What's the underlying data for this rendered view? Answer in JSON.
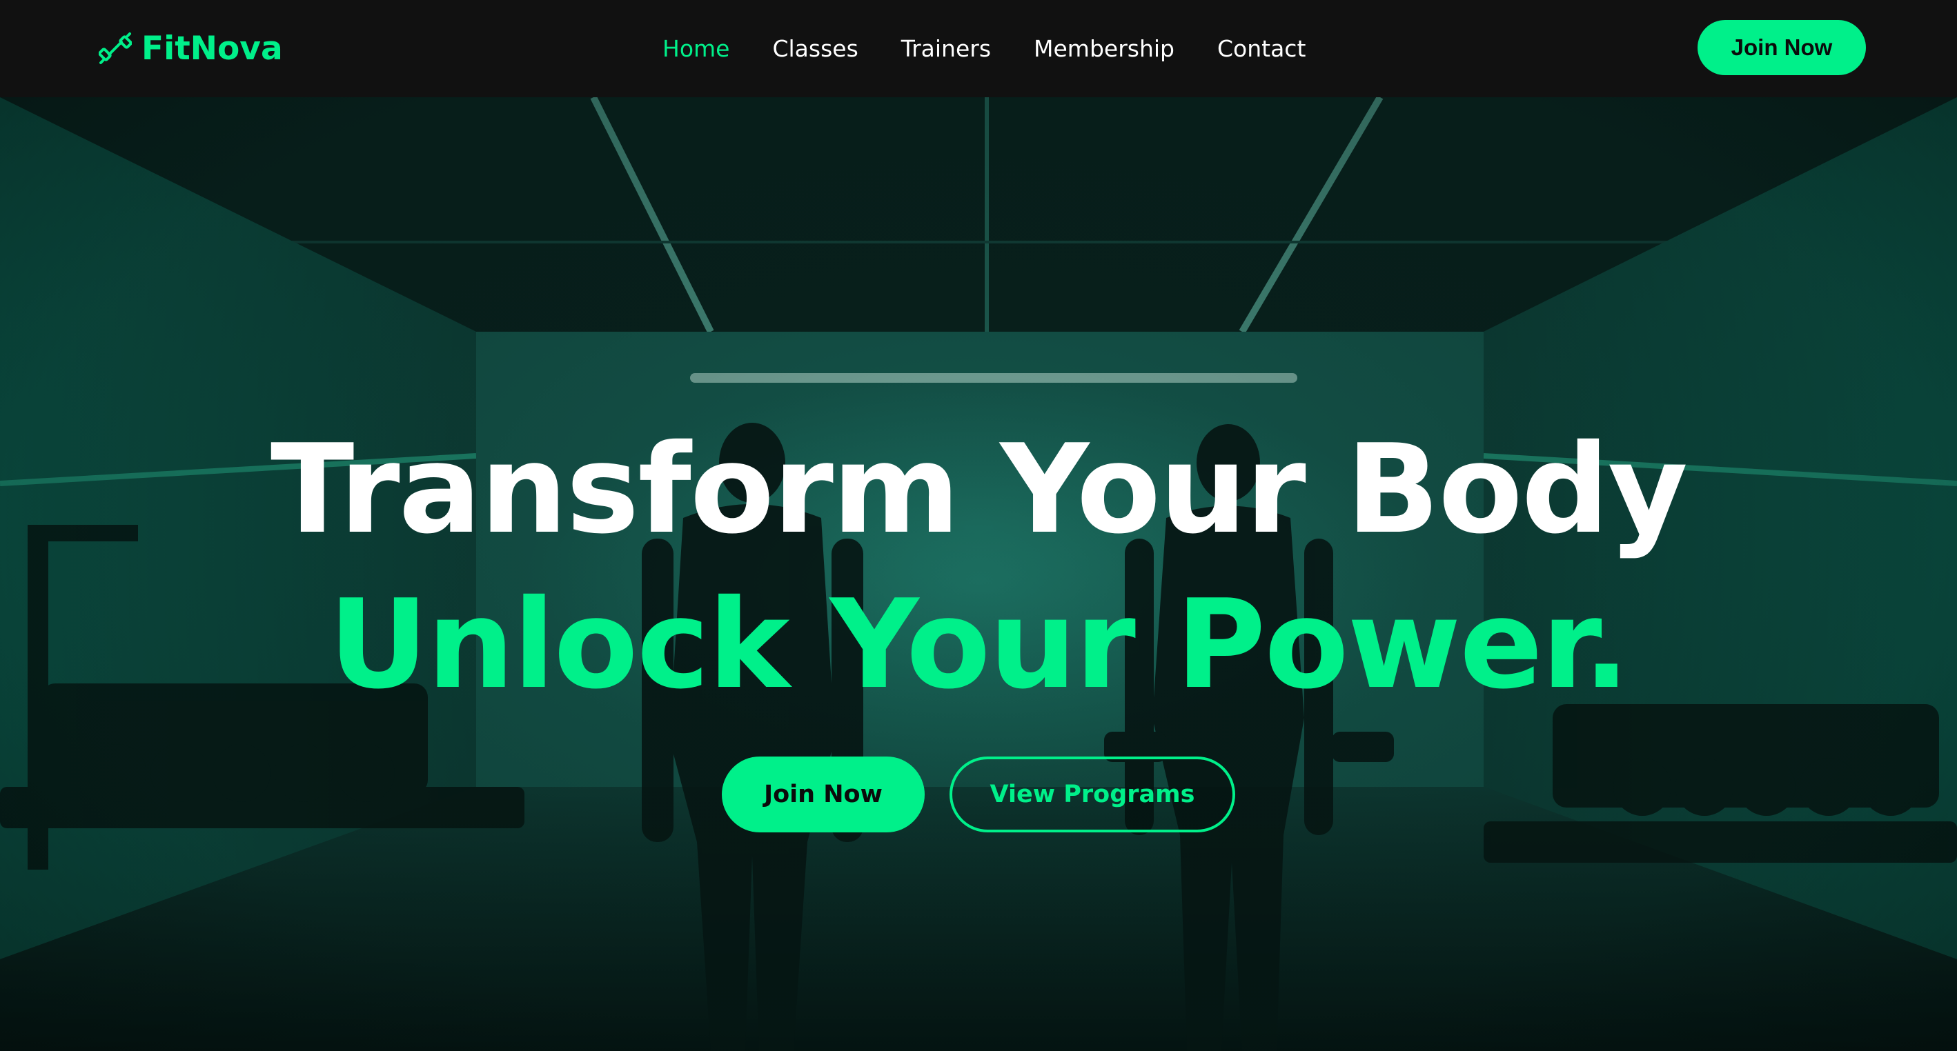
{
  "brand": {
    "name": "FitNova",
    "icon": "dumbbell-icon"
  },
  "nav": {
    "items": [
      {
        "label": "Home",
        "active": true
      },
      {
        "label": "Classes",
        "active": false
      },
      {
        "label": "Trainers",
        "active": false
      },
      {
        "label": "Membership",
        "active": false
      },
      {
        "label": "Contact",
        "active": false
      }
    ],
    "cta_label": "Join Now"
  },
  "hero": {
    "headline_line1": "Transform Your Body",
    "headline_line2": "Unlock Your Power.",
    "primary_button": "Join Now",
    "secondary_button": "View Programs",
    "background": "gym-photo-two-athletes-green-lighting"
  },
  "colors": {
    "accent": "#00f08a",
    "navbar_bg": "#111111",
    "hero_tint": "#0d3b33",
    "text_primary": "#ffffff"
  }
}
